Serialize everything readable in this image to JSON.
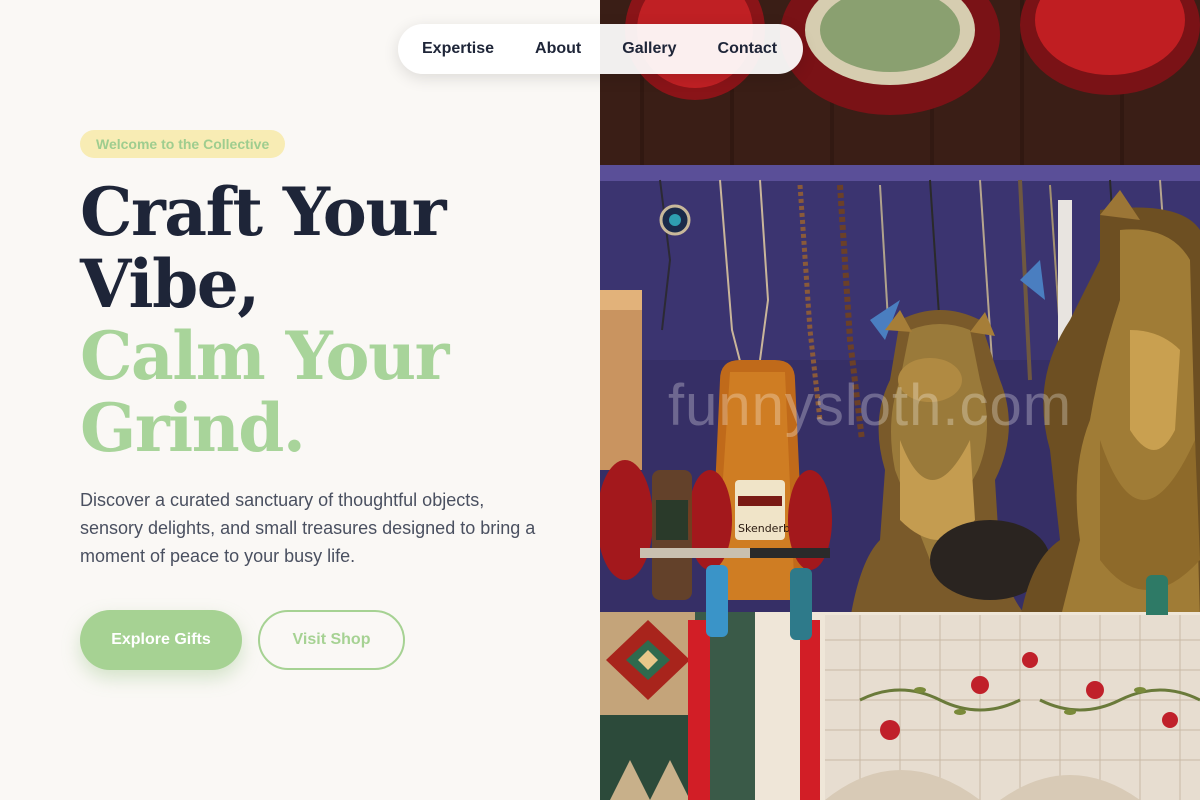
{
  "nav": {
    "items": [
      {
        "label": "Expertise"
      },
      {
        "label": "About"
      },
      {
        "label": "Gallery"
      },
      {
        "label": "Contact"
      }
    ]
  },
  "hero": {
    "badge": "Welcome to the Collective",
    "headline": {
      "line1": "Craft Your",
      "line2": "Vibe,",
      "line3": "Calm Your",
      "line4": "Grind."
    },
    "description": "Discover a curated sanctuary of thoughtful objects, sensory delights, and small treasures designed to bring a moment of peace to your busy life.",
    "primary_button": "Explore Gifts",
    "secondary_button": "Visit Shop"
  },
  "photo": {
    "watermark": "funnysloth.com",
    "bottle_label": "Skenderbeu"
  },
  "colors": {
    "accent_green": "#a6d293",
    "headline_dark": "#1e2538",
    "badge_bg": "#f8ecb4",
    "page_bg": "#faf8f5"
  }
}
